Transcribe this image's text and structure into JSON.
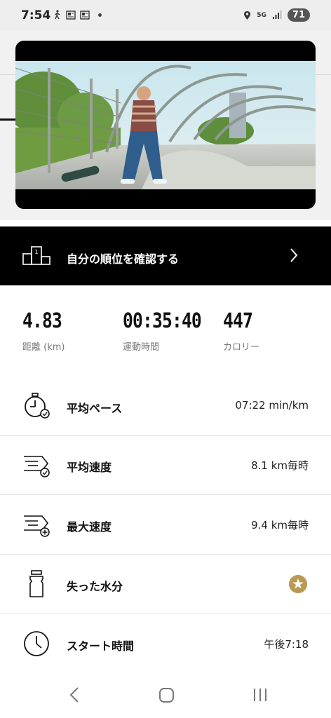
{
  "status_bar": {
    "time": "7:54",
    "network": "5G",
    "battery": "71"
  },
  "rank_banner": {
    "label": "自分の順位を確認する"
  },
  "summary": {
    "distance": {
      "value": "4.83",
      "label": "距離 (km)"
    },
    "duration": {
      "value": "00:35:40",
      "label": "運動時間"
    },
    "calories": {
      "value": "447",
      "label": "カロリー"
    }
  },
  "metrics": [
    {
      "label": "平均ペース",
      "value": "07:22 min/km",
      "icon": "stopwatch-pace-icon"
    },
    {
      "label": "平均速度",
      "value": "8.1 km毎時",
      "icon": "speed-average-icon"
    },
    {
      "label": "最大速度",
      "value": "9.4 km毎時",
      "icon": "speed-max-icon"
    },
    {
      "label": "失った水分",
      "value": "",
      "icon": "water-bottle-icon"
    },
    {
      "label": "スタート時間",
      "value": "午後7:18",
      "icon": "clock-icon"
    }
  ],
  "colors": {
    "banner_bg": "#000000",
    "badge_gold": "#b89a54",
    "status_bg": "#eeeeee"
  }
}
